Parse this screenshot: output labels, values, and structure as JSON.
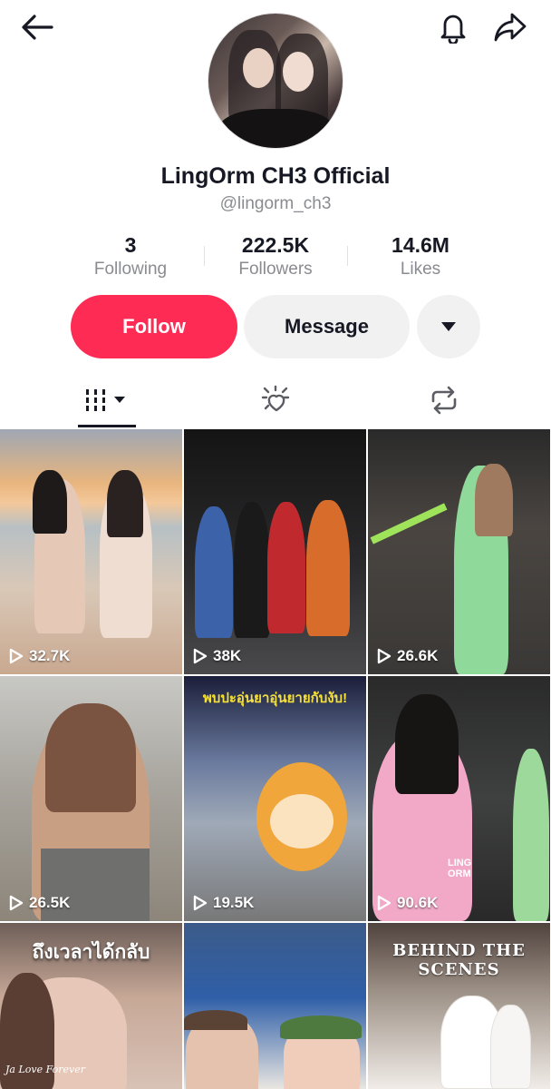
{
  "header": {
    "back_icon": "arrow-left-icon",
    "bell_icon": "bell-icon",
    "share_icon": "share-arrow-icon"
  },
  "profile": {
    "display_name": "LingOrm CH3 Official",
    "handle": "@lingorm_ch3"
  },
  "stats": [
    {
      "value": "3",
      "label": "Following"
    },
    {
      "value": "222.5K",
      "label": "Followers"
    },
    {
      "value": "14.6M",
      "label": "Likes"
    }
  ],
  "actions": {
    "follow_label": "Follow",
    "message_label": "Message",
    "more_icon": "caret-down-icon"
  },
  "tabs": [
    {
      "icon": "grid-bars-icon",
      "selected": true
    },
    {
      "icon": "sparkle-heart-icon",
      "selected": false
    },
    {
      "icon": "repost-icon",
      "selected": false
    }
  ],
  "colors": {
    "follow_bg": "#fe2c55",
    "message_bg": "#f1f1f2",
    "text_primary": "#161823",
    "text_secondary": "#8a8b91"
  },
  "videos": [
    {
      "views": "32.7K"
    },
    {
      "views": "38K"
    },
    {
      "views": "26.6K"
    },
    {
      "views": "26.5K"
    },
    {
      "views": "19.5K"
    },
    {
      "views": "90.6K"
    },
    {
      "caption": "ถึงเวลาได้กลับ"
    },
    {
      "caption": ""
    },
    {
      "caption": "BEHIND THE SCENES"
    }
  ],
  "video_overlays": {
    "cell5_banner": "พบปะอุ่นยาอุ่นยายกับงับ!",
    "cell6_watermark": "LING ORM",
    "cell7_signature": "Ja Love Forever"
  }
}
